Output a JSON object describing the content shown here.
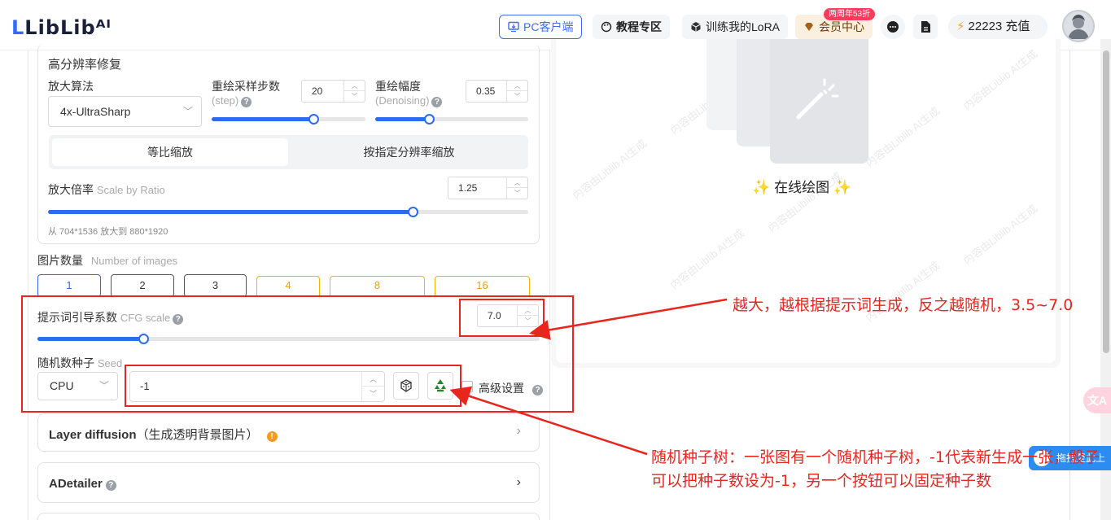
{
  "header": {
    "logo": "LibLibᴬᴵ",
    "pc_client": "PC客户端",
    "tutorial": "教程专区",
    "train_lora": "训练我的LoRA",
    "member_badge": "两周年53折",
    "member_center": "会员中心",
    "credits": "22223 充值"
  },
  "hires": {
    "title": "高分辨率修复",
    "upscaler_label": "放大算法",
    "upscaler_value": "4x-UltraSharp",
    "steps_label": "重绘采样步数",
    "steps_sub": "(step)",
    "steps_value": "20",
    "steps_fraction": 0.66,
    "denoise_label": "重绘幅度",
    "denoise_sub": "(Denoising)",
    "denoise_value": "0.35",
    "denoise_fraction": 0.35,
    "mode_ratio": "等比缩放",
    "mode_resolution": "按指定分辨率缩放",
    "scale_label": "放大倍率",
    "scale_sub": "Scale by Ratio",
    "scale_value": "1.25",
    "scale_fraction": 0.76,
    "resize_note": "从 704*1536 放大到 880*1920"
  },
  "images": {
    "label": "图片数量",
    "sub": "Number of images",
    "options": [
      "1",
      "2",
      "3",
      "4",
      "8",
      "16"
    ],
    "selected": "1"
  },
  "cfg": {
    "label": "提示词引导系数",
    "sub": "CFG scale",
    "value": "7.0",
    "fraction": 0.21
  },
  "seed": {
    "label": "随机数种子",
    "sub": "Seed",
    "device": "CPU",
    "value": "-1",
    "advanced_label": "高级设置"
  },
  "layer_diffusion": {
    "title": "Layer diffusion",
    "note": "（生成透明背景图片）"
  },
  "adetailer": {
    "title": "ADetailer"
  },
  "preview": {
    "title": "在线绘图",
    "watermark": "内容由Liblib AI生成"
  },
  "side": {
    "drag_label": "拖拽至此上"
  },
  "annotations": {
    "cfg_note": "越大，越根据提示词生成，反之越随机，3.5~7.0",
    "seed_note": "随机种子树：一张图有一个随机种子树，-1代表新生成一张，骰子可以把种子数设为-1，另一个按钮可以固定种子数"
  },
  "colors": {
    "accent": "#2f6bef",
    "annotation": "#e8261e",
    "vip": "#f5a100"
  }
}
